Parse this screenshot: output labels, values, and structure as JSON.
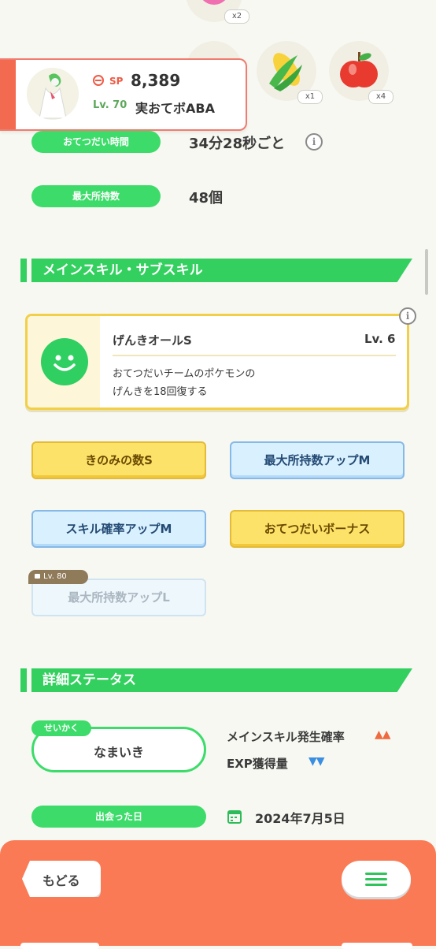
{
  "ingredients": {
    "top_qty": "x2",
    "items": [
      {
        "name": "corn",
        "qty": "x1"
      },
      {
        "name": "apple",
        "qty": "x4"
      }
    ]
  },
  "pokemon": {
    "sp_label": "SP",
    "sp_value": "8,389",
    "level": "Lv. 70",
    "nickname": "実おてボABA"
  },
  "stats": {
    "help_time_label": "おてつだい時間",
    "help_time_value": "34分28秒ごと",
    "max_carry_label": "最大所持数",
    "max_carry_value": "48個"
  },
  "skills_section": {
    "title": "メインスキル・サブスキル",
    "main_skill": {
      "name": "げんきオールS",
      "level": "Lv. 6",
      "desc_line1": "おてつだいチームのポケモンの",
      "desc_line2": "げんきを18回復する"
    },
    "sub_skills": [
      {
        "label": "きのみの数S",
        "style": "yellow"
      },
      {
        "label": "最大所持数アップM",
        "style": "blue"
      },
      {
        "label": "スキル確率アップM",
        "style": "blue"
      },
      {
        "label": "おてつだいボーナス",
        "style": "yellow"
      },
      {
        "label": "最大所持数アップL",
        "style": "locked",
        "lock_level": "Lv. 80"
      }
    ]
  },
  "detail_section": {
    "title": "詳細ステータス",
    "nature_tag": "せいかく",
    "nature": "なまいき",
    "up_stat": "メインスキル発生確率",
    "down_stat": "EXP獲得量",
    "up_arrows": "▲▲",
    "down_arrows": "▼▼",
    "met_label": "出会った日",
    "met_date": "2024年7月5日"
  },
  "nav": {
    "back_label": "もどる",
    "menu_icon": "menu-icon"
  },
  "colors": {
    "accent_green": "#33d05f",
    "bottom_bar": "#fa7a56",
    "up_color": "#ef6a3e",
    "down_color": "#3a8fe0"
  }
}
